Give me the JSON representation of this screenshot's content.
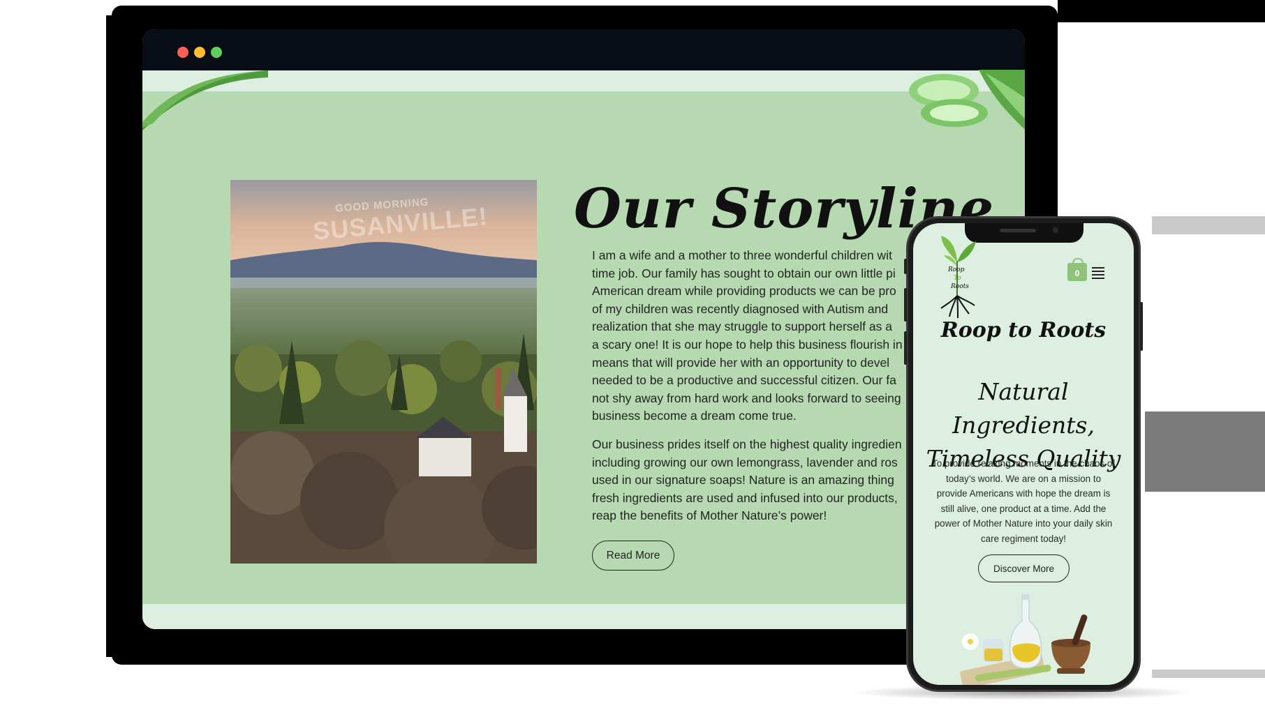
{
  "window": {
    "controls": [
      "close",
      "minimize",
      "maximize"
    ]
  },
  "desktop_page": {
    "photo": {
      "watermark_top": "GOOD MORNING",
      "watermark_main": "SUSANVILLE!"
    },
    "story": {
      "title": "Our Storyline",
      "paragraph1_lines": [
        "I am a wife and a mother to three wonderful children wit",
        "time job. Our family has sought to obtain our own little pi",
        "American dream while providing products we can be pro",
        "of my children was recently diagnosed with Autism and",
        "realization that she may struggle to support herself as a",
        "a scary one! It is our hope to help this business flourish in",
        "means that will provide her with an opportunity to devel",
        "needed to be a productive and successful citizen. Our fa",
        "not shy away from hard work and looks forward to seeing",
        "business become a dream come true."
      ],
      "paragraph2_lines": [
        "Our business prides itself on the highest quality ingredien",
        "including growing our own lemongrass, lavender and ros",
        "used in our signature soaps! Nature is an amazing thing",
        "fresh ingredients are used and infused into our products,",
        "reap the benefits of Mother Nature’s power!"
      ],
      "button_label": "Read More"
    }
  },
  "mobile_page": {
    "logo": {
      "line1": "Roop",
      "line2": "To",
      "line3": "Roots"
    },
    "cart_count": "0",
    "brand": "Roop to Roots",
    "tagline_line1": "Natural Ingredients,",
    "tagline_line2": "Timeless Quality",
    "mission": "To provide relaxing moments in the chaos of today’s world. We are on a mission to provide Americans with hope the dream is still alive, one product at a time. Add the power of Mother Nature into your daily skin care regiment today!",
    "button_label": "Discover More"
  },
  "colors": {
    "section_green": "#b6d9b1",
    "light_mint": "#dcefe1",
    "cart_green": "#8fc27a",
    "titlebar": "#080c14"
  }
}
